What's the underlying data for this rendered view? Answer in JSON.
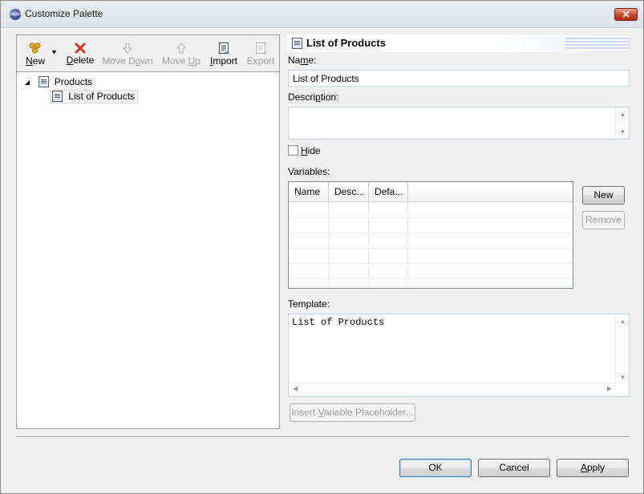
{
  "window": {
    "title": "Customize Palette",
    "close_symbol": "✕"
  },
  "toolbar": {
    "new": {
      "label_u": "N",
      "label_rest": "ew",
      "icon": "new-icon",
      "dropdown": "▾"
    },
    "delete": {
      "label_u": "D",
      "label_rest": "elete",
      "icon": "delete-icon"
    },
    "move_down": {
      "label_pre": "Move D",
      "label_u": "o",
      "label_rest": "wn",
      "icon": "arrow-down-icon"
    },
    "move_up": {
      "label_pre": "Move ",
      "label_u": "U",
      "label_rest": "p",
      "icon": "arrow-up-icon"
    },
    "import": {
      "label_u": "I",
      "label_rest": "mport",
      "icon": "import-icon"
    },
    "export": {
      "label": "Export",
      "icon": "export-icon"
    }
  },
  "tree": {
    "root": {
      "expander": "◢",
      "label": "Products"
    },
    "child": {
      "label": "List of Products"
    }
  },
  "detail": {
    "header_title": "List of Products",
    "name_label_pre": "Na",
    "name_label_u": "m",
    "name_label_rest": "e:",
    "name_value": "List of Products",
    "description_label_pre": "Descri",
    "description_label_u": "p",
    "description_label_rest": "tion:",
    "description_value": "",
    "hide_label_u": "H",
    "hide_label_rest": "ide",
    "hide_checked": false,
    "variables_label": "Variables:",
    "variables_columns": [
      "Name",
      "Desc...",
      "Defa..."
    ],
    "variables_rows": [],
    "new_variable_button": "New",
    "remove_variable_button": "Remove",
    "template_label": "Template:",
    "template_value": "List of Products",
    "insert_placeholder_pre": "Insert ",
    "insert_placeholder_u": "V",
    "insert_placeholder_rest": "ariable Placeholder..."
  },
  "footer": {
    "ok": "OK",
    "cancel": "Cancel",
    "apply_u": "A",
    "apply_rest": "pply"
  },
  "colors": {
    "new_icon": "#e8a623",
    "delete_icon": "#d9342b"
  }
}
